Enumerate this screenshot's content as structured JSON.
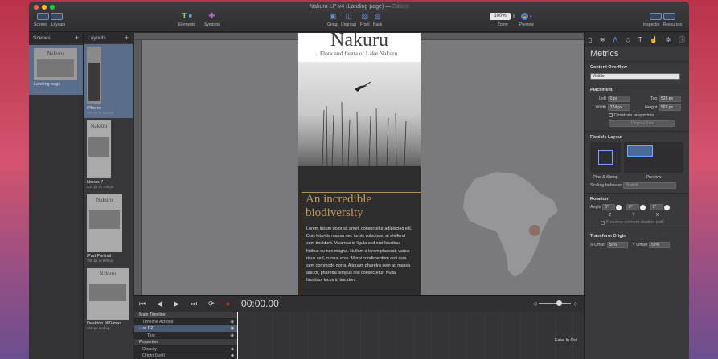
{
  "window": {
    "title": "Nakuru-LP-v4 (Landing page)",
    "title_suffix": "Edited"
  },
  "toolbar": {
    "scenes": "Scenes",
    "layouts": "Layouts",
    "elements": "Elements",
    "symbols": "Symbols",
    "group": "Group",
    "ungroup": "Ungroup",
    "front": "Front",
    "back": "Back",
    "zoom_value": "100%",
    "zoom": "Zoom",
    "preview": "Preview",
    "inspector": "Inspector",
    "resources": "Resources"
  },
  "scenes_panel": {
    "header": "Scenes",
    "add": "+",
    "thumb_title": "Nakuru",
    "item_label": "Landing page"
  },
  "layouts_panel": {
    "header": "Layouts",
    "add": "+",
    "items": [
      {
        "thumb_title": "",
        "label": "iPhone",
        "size": "320 px to 533 px"
      },
      {
        "thumb_title": "Nakuru",
        "label": "Nexus 7",
        "size": "534 px to 768 px"
      },
      {
        "thumb_title": "Nakuru",
        "label": "iPad Portrait",
        "size": "768 px to 960 px"
      },
      {
        "thumb_title": "Nakuru",
        "label": "Desktop 960-max",
        "size": "960 px and up"
      }
    ]
  },
  "canvas": {
    "title": "Nakuru",
    "subtitle": "Flora and fauna of Lake Nakuru.",
    "heading_line1": "An incredible",
    "heading_line2": "biodiversity",
    "body": "Lorem ipsum dolor sit amet, consectetur adipiscing elit. Duis lobortis massa nec turpis vulputate, at eleifend sem tincidunt. Vivamus id ligula sed orci faucibus finibus eu nec magna. Nullam a lorem placerat, varius risus sed, cursus eros. Morbi condimentum orci quis sem commodo porta. Aliquam pharetra sem ac massa auctor, pharetra tempus nisi consectetur. Nulla faucibus lacus id tincidunt"
  },
  "timeline": {
    "time": "00:00.00",
    "rows": [
      {
        "label": "Main Timeline",
        "kind": "header"
      },
      {
        "label": "Timeline Actions",
        "kind": "sub"
      },
      {
        "label": "P2",
        "kind": "element"
      },
      {
        "label": "Text",
        "kind": "sub"
      },
      {
        "label": "Properties",
        "kind": "header"
      },
      {
        "label": "Opacity",
        "kind": "sub"
      },
      {
        "label": "Origin (Left)",
        "kind": "sub"
      }
    ],
    "easing": "Ease In Out"
  },
  "inspector": {
    "title": "Metrics",
    "content_overflow": "Content Overflow",
    "overflow_value": "Visible",
    "placement": "Placement",
    "left_label": "Left",
    "left_value": "0 px",
    "top_label": "Top",
    "top_value": "526 px",
    "width_label": "Width",
    "width_value": "324 px",
    "height_label": "Height",
    "height_value": "569 px",
    "constrain": "Constrain proportions",
    "original_size": "Original Size",
    "flexible_layout": "Flexible Layout",
    "pins_sizing": "Pins & Sizing",
    "preview": "Preview",
    "scaling_label": "Scaling behavior",
    "scaling_value": "Stretch",
    "rotation": "Rotation",
    "angle_label": "Angle",
    "angle_value": "0°",
    "z_value": "0°",
    "x_value": "0°",
    "rot_z": "Z",
    "rot_y": "Y",
    "rot_x": "X",
    "preserve": "Preserve element rotation path",
    "transform_origin": "Transform Origin",
    "x_offset_label": "X Offset",
    "x_offset_value": "50%",
    "y_offset_label": "Y Offset",
    "y_offset_value": "50%"
  },
  "colors": {
    "accent_gold": "#c79a5d",
    "window_bg": "#2c2c2e",
    "record": "#d9302c"
  }
}
